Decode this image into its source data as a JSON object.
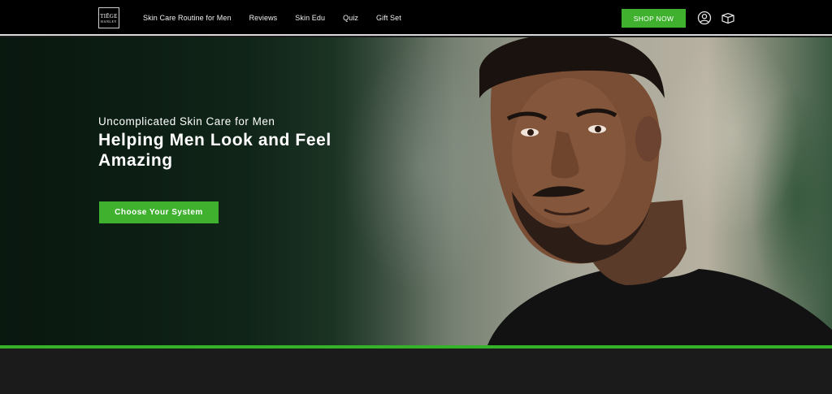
{
  "brand": {
    "logo_line1": "TIĒGE",
    "logo_line2": "HANLEY"
  },
  "nav": {
    "items": [
      {
        "label": "Skin Care Routine for Men"
      },
      {
        "label": "Reviews"
      },
      {
        "label": "Skin Edu"
      },
      {
        "label": "Quiz"
      },
      {
        "label": "Gift Set"
      }
    ]
  },
  "header": {
    "shop_label": "SHOP NOW",
    "account_icon": "account-icon",
    "cart_icon": "box-cart-icon"
  },
  "hero": {
    "subtitle": "Uncomplicated Skin Care for Men",
    "headline": "Helping Men Look and Feel Amazing",
    "cta_label": "Choose Your System"
  },
  "colors": {
    "accent": "#3fb12f",
    "header_bg": "#000000",
    "footer_bg": "#1b1b1b"
  }
}
